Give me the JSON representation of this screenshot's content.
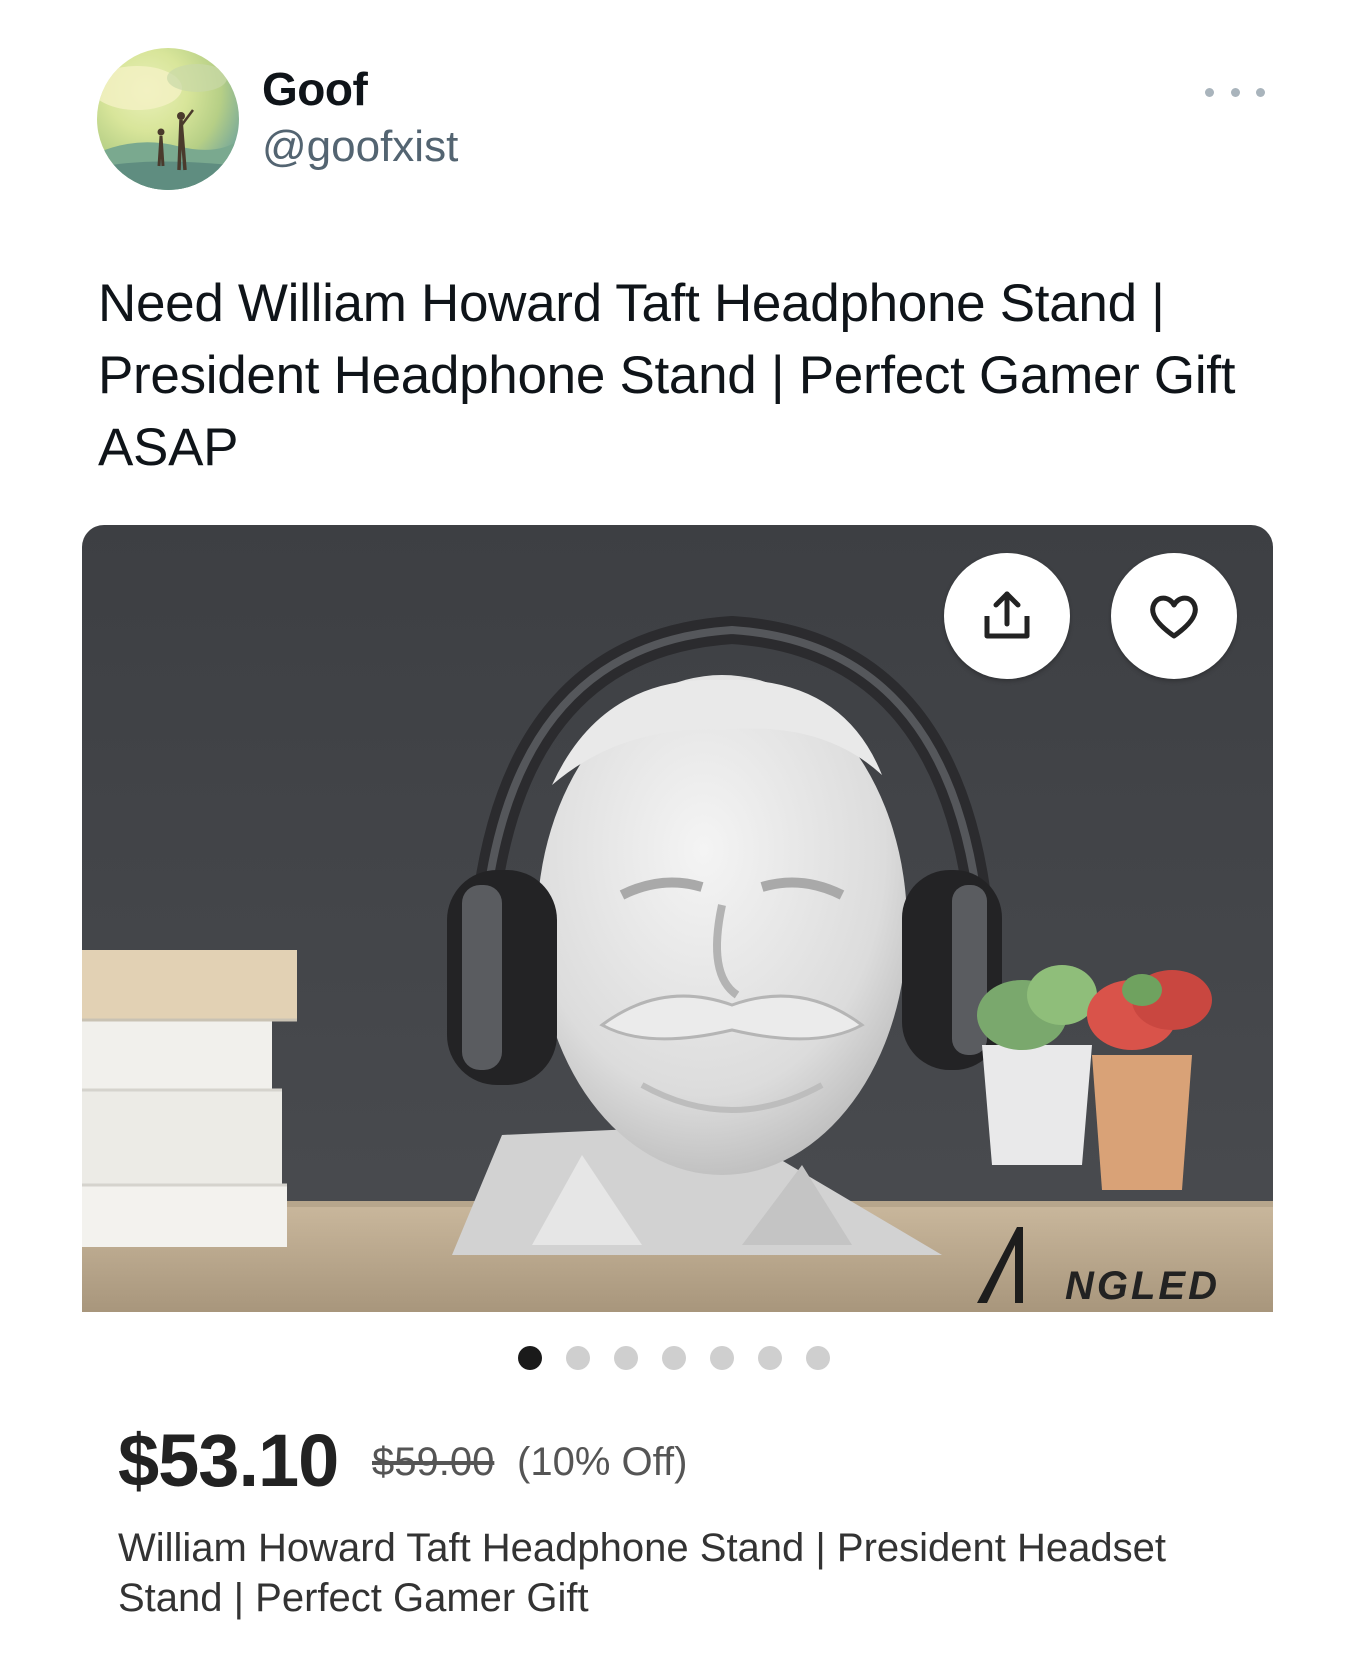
{
  "tweet": {
    "author_name": "Goof",
    "author_handle": "@goofxist",
    "text": "Need William Howard Taft Headphone Stand | President Headphone Stand | Perfect Gamer Gift ASAP",
    "more_icon": "more-horizontal-icon"
  },
  "listing": {
    "image_alt": "White bust of William Howard Taft wearing black headphones on a wooden shelf",
    "watermark": "NGLED",
    "share_icon": "share-icon",
    "favorite_icon": "heart-icon",
    "carousel": {
      "count": 7,
      "active_index": 0
    },
    "price": "$53.10",
    "original_price": "$59.00",
    "discount": "(10% Off)",
    "title": "William Howard Taft Headphone Stand | President Headset Stand | Perfect Gamer Gift"
  }
}
